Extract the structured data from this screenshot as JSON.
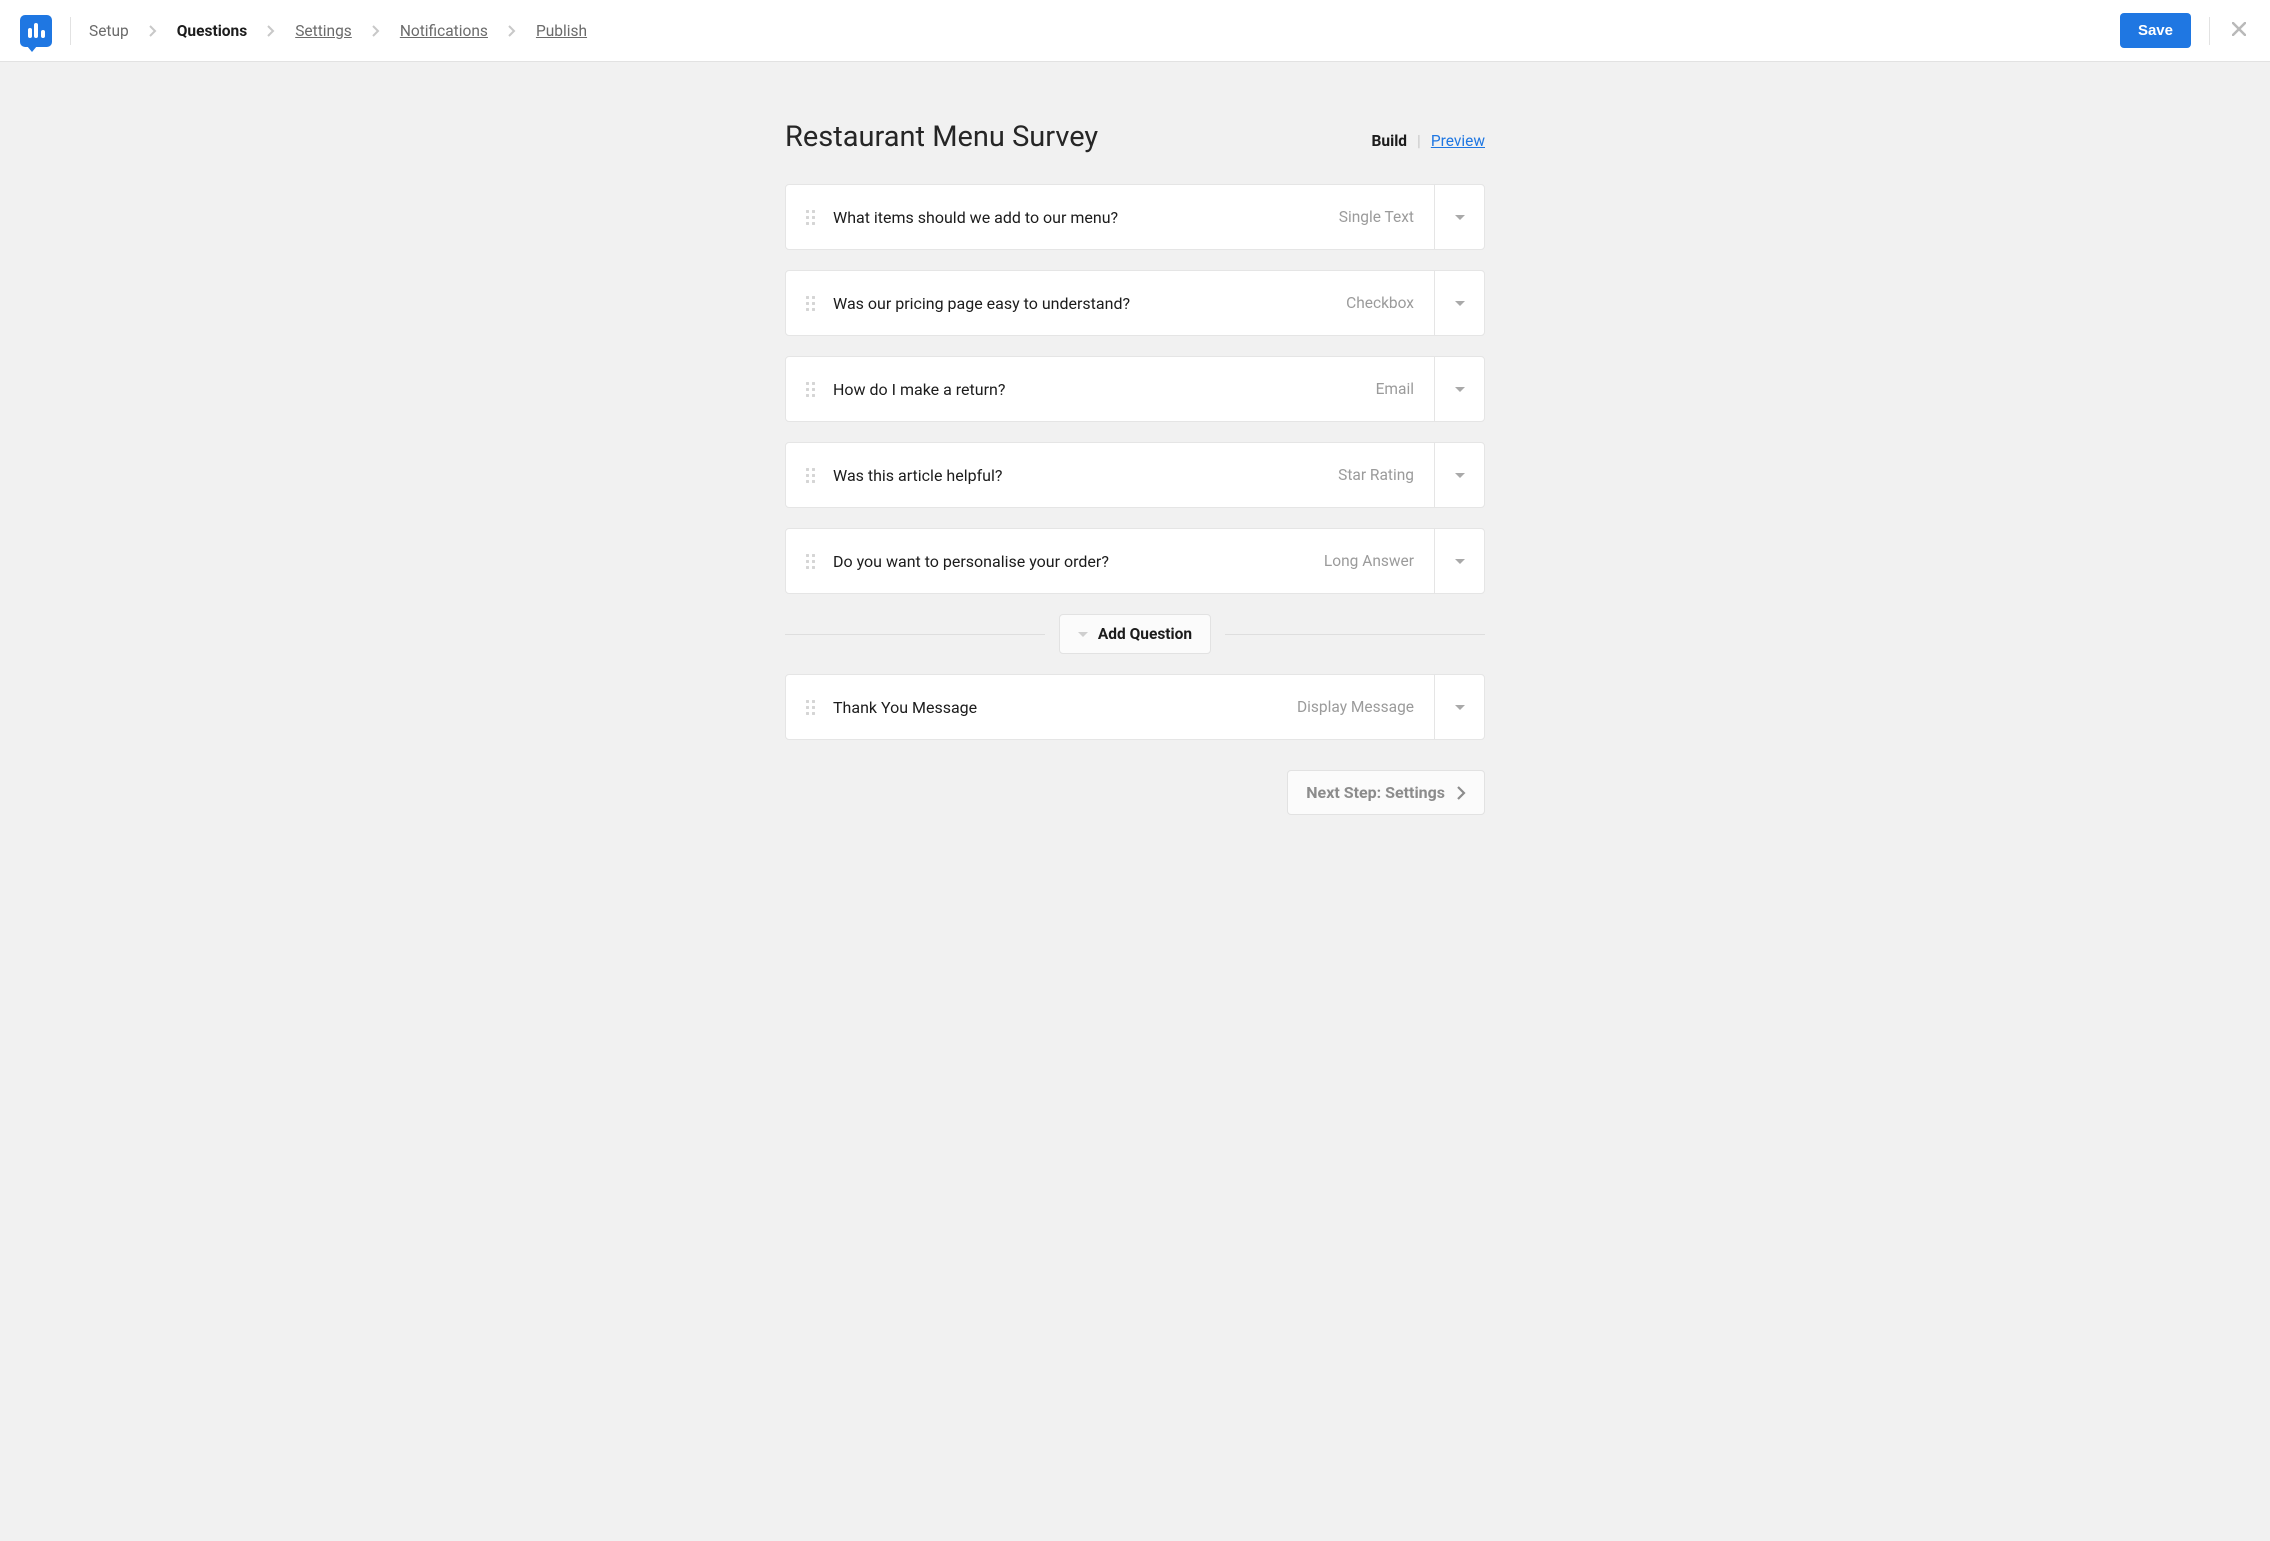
{
  "nav": {
    "setup": "Setup",
    "questions": "Questions",
    "settings": "Settings",
    "notifications": "Notifications",
    "publish": "Publish",
    "save": "Save"
  },
  "header": {
    "title": "Restaurant Menu Survey",
    "build": "Build",
    "preview": "Preview"
  },
  "questions": [
    {
      "text": "What items should we add to our menu?",
      "type": "Single Text"
    },
    {
      "text": "Was our pricing page easy to understand?",
      "type": "Checkbox"
    },
    {
      "text": "How do I make a return?",
      "type": "Email"
    },
    {
      "text": "Was this article helpful?",
      "type": "Star Rating"
    },
    {
      "text": "Do you want to personalise your order?",
      "type": "Long Answer"
    }
  ],
  "add_question": "Add Question",
  "thankyou": {
    "text": "Thank You Message",
    "type": "Display Message"
  },
  "next_step": "Next Step: Settings"
}
